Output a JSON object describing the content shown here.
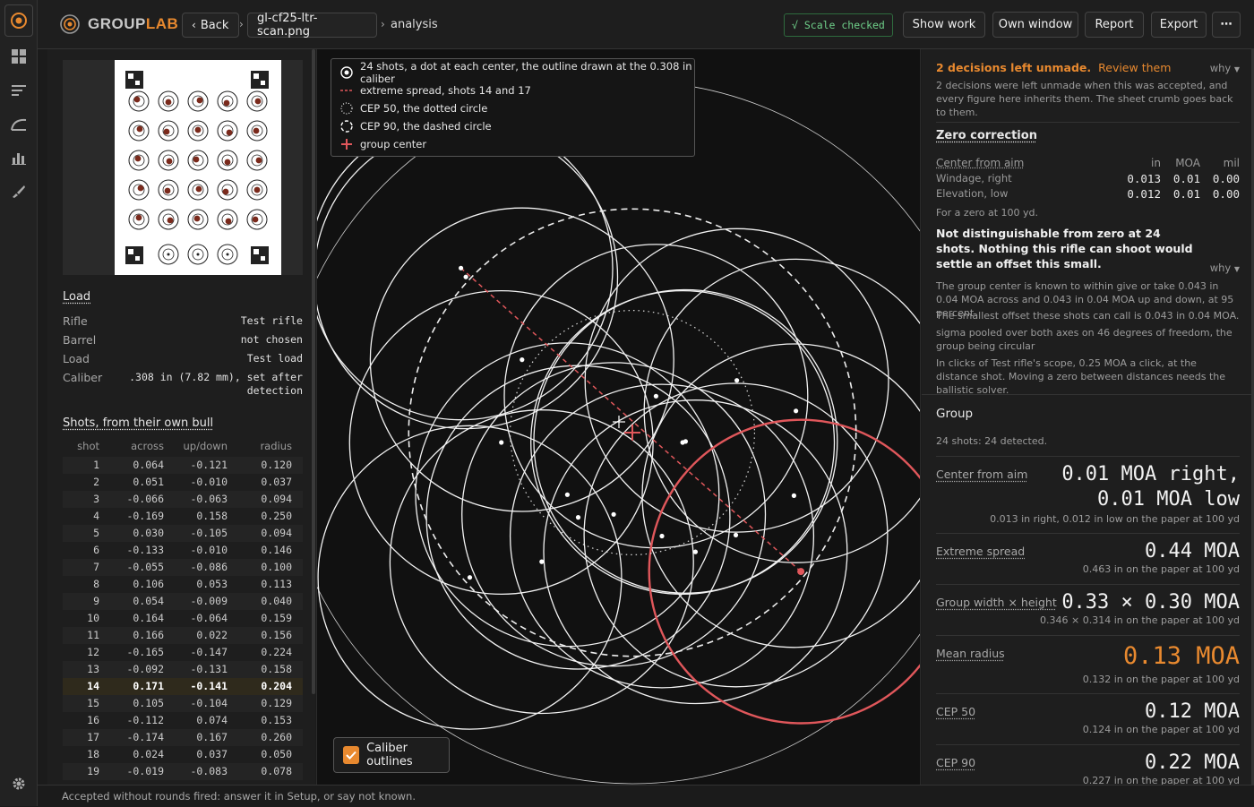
{
  "app": {
    "brand_pre": "GROUP",
    "brand_post": "LAB"
  },
  "breadcrumbs": {
    "back": "Back",
    "file": "gl-cf25-ltr-scan.png",
    "current": "analysis"
  },
  "toolbar": {
    "scale_badge": "√ Scale checked",
    "show_work": "Show work",
    "own_window": "Own window",
    "report": "Report",
    "export": "Export",
    "more": "⋯"
  },
  "rail_icons": [
    "app-logo-icon",
    "grid-icon",
    "list-icon",
    "curve-icon",
    "bar-chart-icon",
    "brush-icon",
    "settings-icon"
  ],
  "load": {
    "title": "Load",
    "rows": [
      {
        "k": "Rifle",
        "v": "Test rifle"
      },
      {
        "k": "Barrel",
        "v": "not chosen"
      },
      {
        "k": "Load",
        "v": "Test load"
      },
      {
        "k": "Caliber",
        "v": ".308 in (7.82 mm), set after detection"
      }
    ]
  },
  "shots": {
    "title": "Shots, from their own bull",
    "columns": [
      "shot",
      "across",
      "up/down",
      "radius"
    ],
    "highlight": 14,
    "rows": [
      [
        "1",
        "0.064",
        "-0.121",
        "0.120"
      ],
      [
        "2",
        "0.051",
        "-0.010",
        "0.037"
      ],
      [
        "3",
        "-0.066",
        "-0.063",
        "0.094"
      ],
      [
        "4",
        "-0.169",
        "0.158",
        "0.250"
      ],
      [
        "5",
        "0.030",
        "-0.105",
        "0.094"
      ],
      [
        "6",
        "-0.133",
        "-0.010",
        "0.146"
      ],
      [
        "7",
        "-0.055",
        "-0.086",
        "0.100"
      ],
      [
        "8",
        "0.106",
        "0.053",
        "0.113"
      ],
      [
        "9",
        "0.054",
        "-0.009",
        "0.040"
      ],
      [
        "10",
        "0.164",
        "-0.064",
        "0.159"
      ],
      [
        "11",
        "0.166",
        "0.022",
        "0.156"
      ],
      [
        "12",
        "-0.165",
        "-0.147",
        "0.224"
      ],
      [
        "13",
        "-0.092",
        "-0.131",
        "0.158"
      ],
      [
        "14",
        "0.171",
        "-0.141",
        "0.204"
      ],
      [
        "15",
        "0.105",
        "-0.104",
        "0.129"
      ],
      [
        "16",
        "-0.112",
        "0.074",
        "0.153"
      ],
      [
        "17",
        "-0.174",
        "0.167",
        "0.260"
      ],
      [
        "18",
        "0.024",
        "0.037",
        "0.050"
      ],
      [
        "19",
        "-0.019",
        "-0.083",
        "0.078"
      ]
    ]
  },
  "legend": [
    {
      "icon": "dot-circle-icon",
      "text": "24 shots, a dot at each center, the outline drawn at the 0.308 in caliber"
    },
    {
      "icon": "dashed-line-icon",
      "text": "extreme spread, shots 14 and 17"
    },
    {
      "icon": "dotted-circle-icon",
      "text": "CEP 50, the dotted circle"
    },
    {
      "icon": "dashed-circle-icon",
      "text": "CEP 90, the dashed circle"
    },
    {
      "icon": "plus-icon",
      "text": "group center"
    }
  ],
  "toggle": {
    "label": "Caliber outlines",
    "checked": true
  },
  "right": {
    "warn_title": "2 decisions left unmade.",
    "warn_link": "Review them",
    "why": "why",
    "warn_text": "2 decisions were left unmade when this was accepted, and every figure here inherits them. The sheet crumb goes back to them.",
    "zero_title": "Zero correction",
    "zc_label": "Center from aim",
    "zc_cols": [
      "in",
      "MOA",
      "mil"
    ],
    "zc_rows": [
      {
        "k": "Windage, right",
        "vals": [
          "0.013",
          "0.01",
          "0.00"
        ]
      },
      {
        "k": "Elevation, low",
        "vals": [
          "0.012",
          "0.01",
          "0.00"
        ]
      }
    ],
    "zero_note": "For a zero at 100 yd.",
    "bold_note": "Not distinguishable from zero at 24 shots. Nothing this rifle can shoot would settle an offset this small.",
    "notes": [
      "The group center is known to within give or take 0.043 in  0.04 MOA across and 0.043 in  0.04 MOA up and down, at 95 percent.",
      "The smallest offset these shots can call is 0.043 in  0.04 MOA.",
      "sigma pooled over both axes on 46 degrees of freedom, the group being circular",
      "In clicks of Test rifle's scope, 0.25 MOA a click, at the distance shot. Moving a zero between distances needs the ballistic solver."
    ],
    "group_title": "Group",
    "group_count": "24 shots: 24 detected.",
    "metrics": [
      {
        "label": "Center from aim",
        "value": "0.01 MOA right,",
        "value2": "0.01 MOA low",
        "sub": "0.013 in right, 0.012 in low on the paper at 100 yd"
      },
      {
        "label": "Extreme spread",
        "value": "0.44 MOA",
        "sub": "0.463 in on the paper at 100 yd"
      },
      {
        "label": "Group width × height",
        "value": "0.33 × 0.30 MOA",
        "sub": "0.346 × 0.314 in on the paper at 100 yd"
      },
      {
        "label": "Mean radius",
        "value": "0.13 MOA",
        "sub": "0.132 in on the paper at 100 yd"
      },
      {
        "label": "CEP 50",
        "value": "0.12 MOA",
        "sub": "0.124 in on the paper at 100 yd"
      },
      {
        "label": "CEP 90",
        "value": "0.22 MOA",
        "sub": "0.227 in on the paper at 100 yd"
      }
    ]
  },
  "status": "Accepted without rounds fired: answer it in Setup, or say not known.",
  "colors": {
    "accent": "#e8892f",
    "red": "#e0575b",
    "ok": "#6fd08a"
  }
}
